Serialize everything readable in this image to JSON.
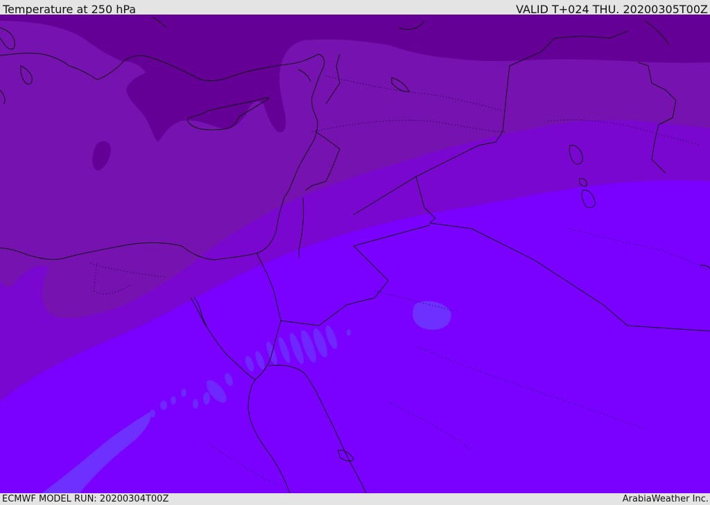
{
  "header": {
    "title": "Temperature at 250 hPa",
    "valid_time": "VALID T+024 THU. 20200305T00Z"
  },
  "footer": {
    "model_run": "ECMWF MODEL RUN: 20200304T00Z",
    "credit": "ArabiaWeather Inc."
  },
  "colors": {
    "band_coldest": "#650096",
    "band_cold": "#7612b0",
    "band_mid": "#7a07d0",
    "band_warm": "#7a00ff",
    "warm_patch": "#6d30ff",
    "coastline": "#111111",
    "frame": "#e4e4e4"
  }
}
